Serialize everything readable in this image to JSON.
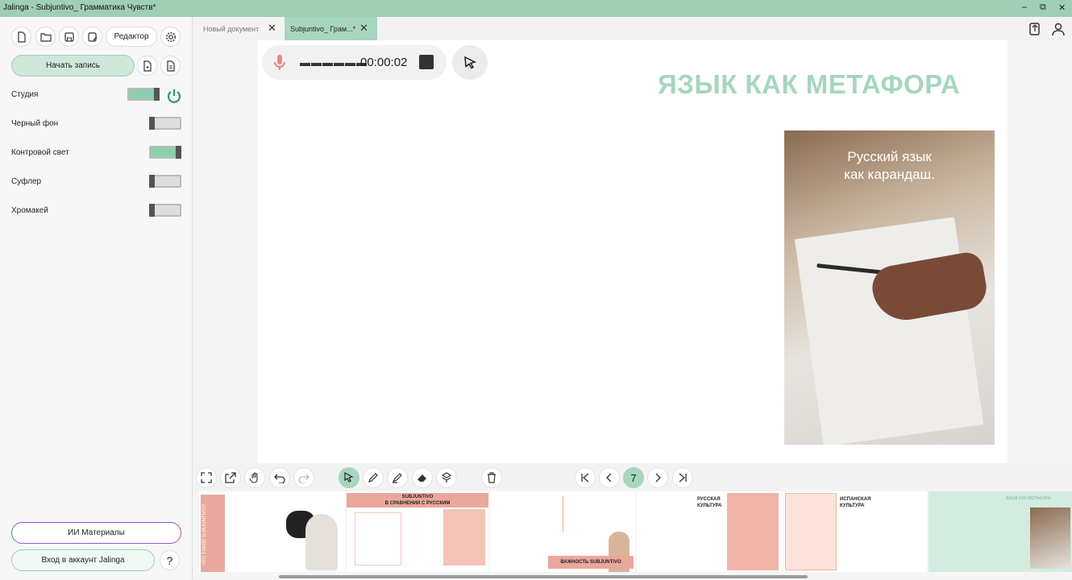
{
  "window": {
    "title": "Jalinga - Subjuntivo_ Грамматика Чувств*",
    "controls": [
      "–",
      "⧉",
      "✕"
    ]
  },
  "sidebar": {
    "editor_label": "Редактор",
    "record_label": "Начать запись",
    "toggles": [
      {
        "label": "Студия",
        "on": true
      },
      {
        "label": "Черный фон",
        "on": false
      },
      {
        "label": "Контровой свет",
        "on": true
      },
      {
        "label": "Суфлер",
        "on": false
      },
      {
        "label": "Хромакей",
        "on": false
      }
    ],
    "ai_materials_label": "ИИ Материалы",
    "login_label": "Вход в аккаунт Jalinga",
    "help_label": "?"
  },
  "tabs": [
    {
      "label": "Новый документ",
      "active": false
    },
    {
      "label": "Subjuntivo_ Грам...*",
      "active": true
    }
  ],
  "recorder": {
    "level": "▬▬▬▬▬▬",
    "time": "00:00:02"
  },
  "slide": {
    "title": "ЯЗЫК КАК МЕТАФОРА",
    "photo_caption_line1": "Русский язык",
    "photo_caption_line2": "как карандаш.",
    "accent_color": "#a6d6bd"
  },
  "navigation": {
    "current_page": "7"
  },
  "thumbnails": {
    "t1_vertical": "ЧТО ТАКОЕ SUBJUNTIVO?",
    "t2_title_line1": "SUBJUNTIVO",
    "t2_title_line2": "В СРАВНЕНИИ С РУССКИМ",
    "t3_banner": "ВАЖНОСТЬ SUBJUNTIVO",
    "t4_title_line1": "РУССКАЯ",
    "t4_title_line2": "КУЛЬТУРА",
    "t5_title_line1": "ИСПАНСКАЯ",
    "t5_title_line2": "КУЛЬТУРА",
    "t6_title": "ЯЗЫК КАК МЕТАФОРА"
  }
}
